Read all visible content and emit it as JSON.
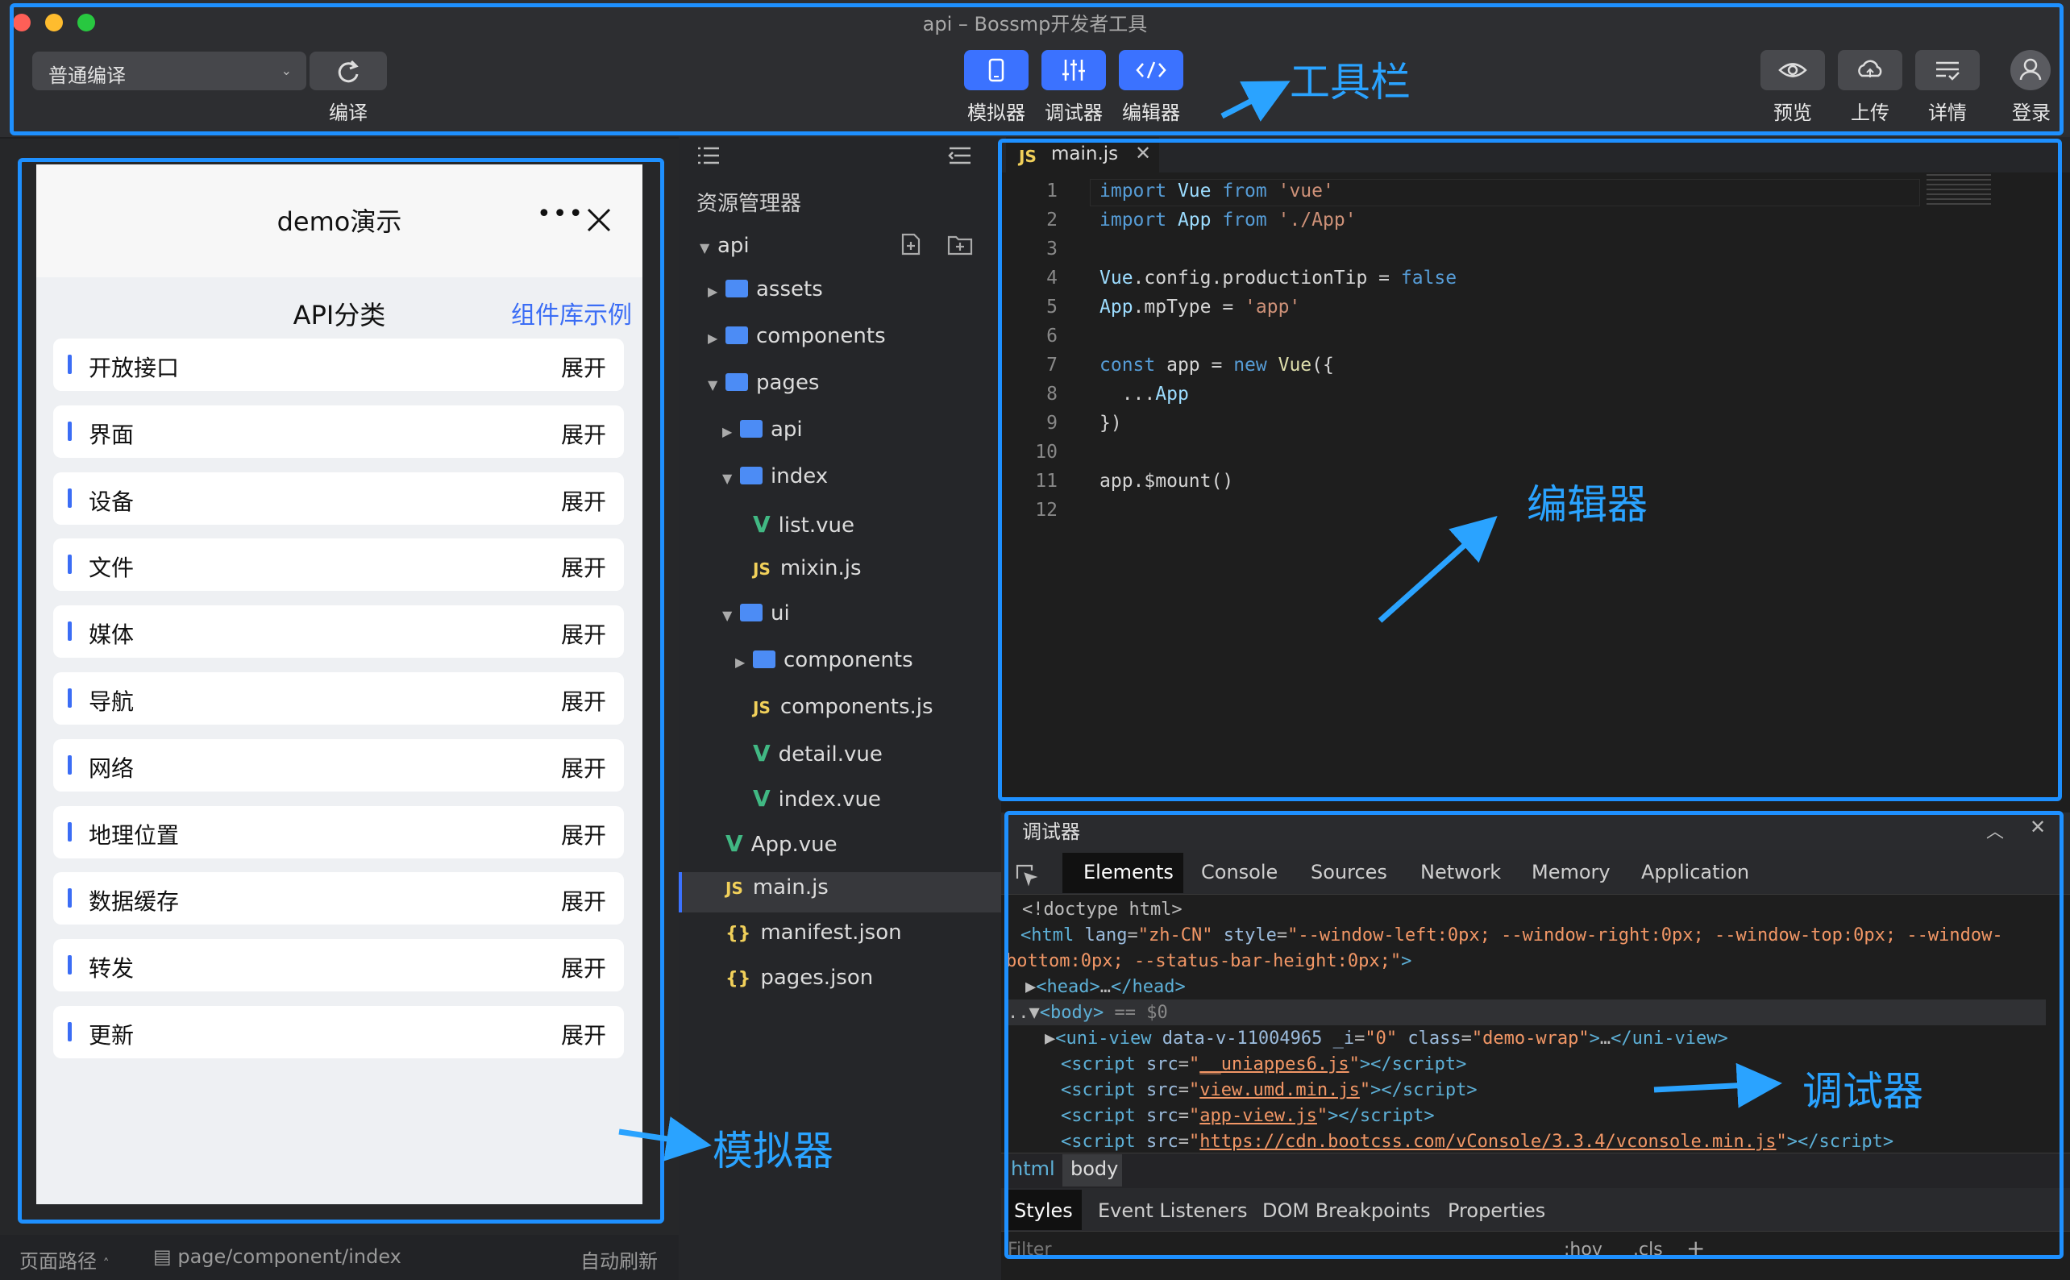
{
  "window": {
    "title": "api – Bossmp开发者工具"
  },
  "toolbar": {
    "compile_mode": "普通编译",
    "compile_label": "编译",
    "modes": [
      "模拟器",
      "调试器",
      "编辑器"
    ],
    "actions": [
      "预览",
      "上传",
      "详情",
      "登录"
    ]
  },
  "annotations": {
    "toolbar": "工具栏",
    "editor": "编辑器",
    "debugger": "调试器",
    "simulator": "模拟器"
  },
  "simulator": {
    "title": "demo演示",
    "section": "API分类",
    "link": "组件库示例",
    "items": [
      {
        "name": "开放接口",
        "action": "展开"
      },
      {
        "name": "界面",
        "action": "展开"
      },
      {
        "name": "设备",
        "action": "展开"
      },
      {
        "name": "文件",
        "action": "展开"
      },
      {
        "name": "媒体",
        "action": "展开"
      },
      {
        "name": "导航",
        "action": "展开"
      },
      {
        "name": "网络",
        "action": "展开"
      },
      {
        "name": "地理位置",
        "action": "展开"
      },
      {
        "name": "数据缓存",
        "action": "展开"
      },
      {
        "name": "转发",
        "action": "展开"
      },
      {
        "name": "更新",
        "action": "展开"
      }
    ],
    "status": {
      "path_label": "页面路径",
      "path": "page/component/index",
      "auto_refresh": "自动刷新"
    }
  },
  "explorer": {
    "title": "资源管理器",
    "root": "api",
    "tree": [
      "assets",
      "components",
      "pages",
      "api",
      "index",
      "list.vue",
      "mixin.js",
      "ui",
      "components",
      "components.js",
      "detail.vue",
      "index.vue",
      "App.vue",
      "main.js",
      "manifest.json",
      "pages.json"
    ]
  },
  "editor": {
    "tab": "main.js",
    "lines": [
      "1",
      "2",
      "3",
      "4",
      "5",
      "6",
      "7",
      "8",
      "9",
      "10",
      "11",
      "12"
    ]
  },
  "debugger": {
    "title": "调试器",
    "tabs": [
      "Elements",
      "Console",
      "Sources",
      "Network",
      "Memory",
      "Application"
    ],
    "breadcrumb": [
      "html",
      "body"
    ],
    "subtabs": [
      "Styles",
      "Event Listeners",
      "DOM Breakpoints",
      "Properties"
    ],
    "filter_placeholder": "Filter",
    "filter_tools": [
      ":hov",
      ".cls",
      "+"
    ]
  }
}
